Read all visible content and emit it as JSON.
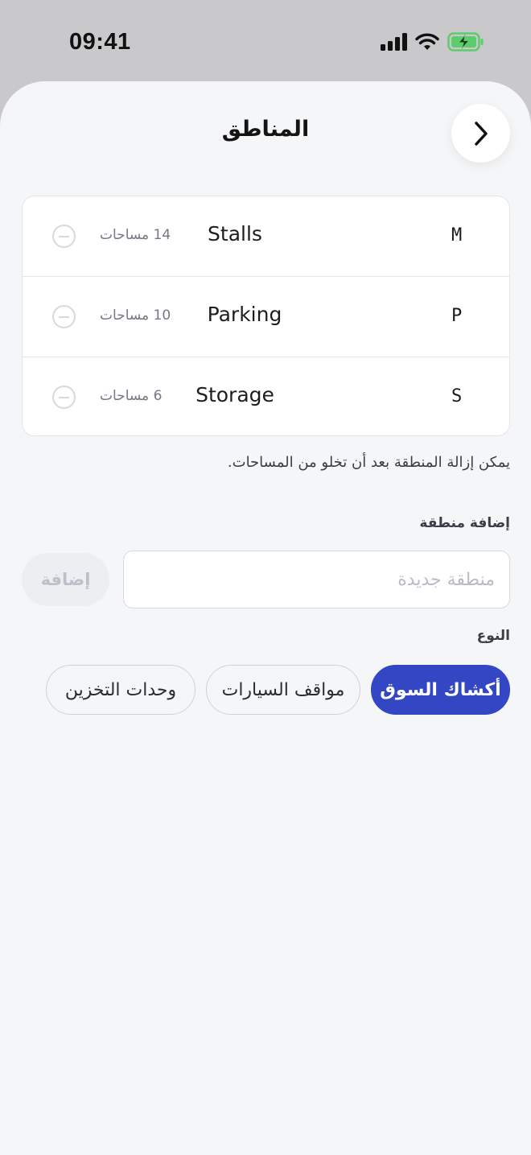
{
  "status_bar": {
    "time": "09:41"
  },
  "header": {
    "title": "المناطق",
    "back_icon": "chevron-right-icon"
  },
  "zones": [
    {
      "code": "M",
      "name": "Stalls",
      "count": "14 مساحات"
    },
    {
      "code": "P",
      "name": "Parking",
      "count": "10 مساحات"
    },
    {
      "code": "S",
      "name": "Storage",
      "count": "6 مساحات"
    }
  ],
  "hint": "يمكن إزالة المنطقة بعد أن تخلو من المساحات.",
  "add_zone": {
    "label": "إضافة منطقة",
    "placeholder": "منطقة جديدة",
    "value": "",
    "button_label": "إضافة"
  },
  "type": {
    "label": "النوع",
    "options": [
      "أكشاك السوق",
      "مواقف السيارات",
      "وحدات التخزين"
    ],
    "selected": "أكشاك السوق"
  },
  "colors": {
    "accent": "#3346c3",
    "background": "#f5f6f8"
  }
}
